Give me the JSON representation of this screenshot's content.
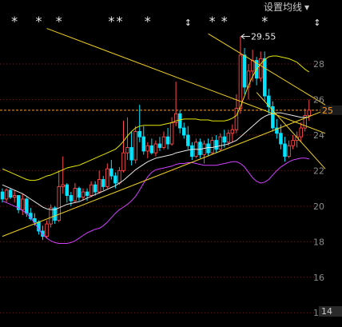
{
  "header": {
    "ma_settings_label": "设置均线",
    "dropdown_icon": "caret-down-icon"
  },
  "colors": {
    "background": "#000000",
    "grid": "#6e1a1a",
    "up": "#ff4a4a",
    "down": "#00e4ff",
    "boll_mid": "#e6e6e6",
    "boll_upper": "#e6e600",
    "boll_lower": "#d040ff",
    "trend": "#f0d020",
    "last_price": "#ff9a1a",
    "axis_text": "#8c8c8c",
    "star": "#e8e8e8"
  },
  "chart_data": {
    "type": "candlestick",
    "title": "",
    "xlabel": "",
    "ylabel": "",
    "ylim": [
      13.2,
      31.6
    ],
    "y_tick_labels": [
      "28",
      "26",
      "24",
      "22",
      "20",
      "18",
      "16",
      "14"
    ],
    "y_ticks": [
      28,
      26,
      24,
      22,
      20,
      18,
      16,
      14
    ],
    "grid": true,
    "current_price": 25.4,
    "current_price_tag": "25",
    "right_edge_tags": [
      {
        "text": "14",
        "value": 14.1
      }
    ],
    "annotation": {
      "text": "29.55",
      "value": 29.55
    },
    "marker_symbols": [
      "*",
      "*",
      "*",
      "*",
      "*",
      "*",
      "↕",
      "*",
      "*",
      "*",
      "↕"
    ],
    "candles": [
      [
        20.8,
        21.0,
        20.2,
        20.4
      ],
      [
        20.4,
        21.0,
        20.2,
        20.9
      ],
      [
        20.9,
        21.0,
        20.4,
        20.5
      ],
      [
        20.5,
        20.9,
        20.2,
        20.6
      ],
      [
        20.6,
        20.6,
        19.6,
        19.8
      ],
      [
        19.8,
        20.7,
        19.5,
        20.4
      ],
      [
        20.4,
        20.5,
        19.4,
        19.6
      ],
      [
        19.6,
        19.9,
        19.2,
        19.3
      ],
      [
        19.3,
        19.6,
        18.9,
        19.1
      ],
      [
        19.1,
        19.2,
        18.4,
        18.6
      ],
      [
        18.6,
        18.9,
        18.1,
        18.3
      ],
      [
        18.3,
        19.2,
        18.2,
        19.0
      ],
      [
        19.0,
        20.1,
        18.8,
        19.9
      ],
      [
        19.9,
        20.0,
        19.0,
        19.2
      ],
      [
        19.2,
        22.0,
        19.1,
        21.1
      ],
      [
        21.1,
        22.8,
        20.7,
        21.2
      ],
      [
        21.2,
        21.3,
        20.2,
        20.6
      ],
      [
        20.6,
        20.8,
        20.0,
        20.3
      ],
      [
        20.3,
        21.3,
        20.2,
        21.0
      ],
      [
        21.0,
        21.1,
        20.3,
        20.5
      ],
      [
        20.5,
        21.0,
        20.3,
        20.8
      ],
      [
        20.8,
        21.0,
        20.3,
        20.6
      ],
      [
        20.6,
        21.4,
        20.5,
        21.2
      ],
      [
        21.2,
        21.4,
        20.6,
        20.8
      ],
      [
        20.8,
        22.0,
        20.7,
        21.5
      ],
      [
        21.5,
        21.7,
        20.9,
        21.1
      ],
      [
        21.1,
        22.4,
        21.0,
        22.1
      ],
      [
        22.1,
        22.6,
        21.5,
        21.7
      ],
      [
        21.7,
        21.9,
        21.0,
        21.3
      ],
      [
        21.3,
        22.2,
        21.2,
        22.0
      ],
      [
        22.0,
        24.8,
        21.9,
        23.0
      ],
      [
        23.0,
        25.0,
        22.6,
        23.3
      ],
      [
        23.3,
        24.2,
        22.3,
        22.6
      ],
      [
        22.6,
        24.5,
        22.4,
        24.2
      ],
      [
        24.2,
        25.7,
        23.6,
        23.9
      ],
      [
        23.9,
        24.5,
        22.9,
        23.1
      ],
      [
        23.1,
        23.6,
        22.7,
        23.4
      ],
      [
        23.4,
        23.8,
        22.9,
        23.0
      ],
      [
        23.0,
        23.7,
        22.8,
        23.5
      ],
      [
        23.5,
        23.9,
        23.1,
        23.3
      ],
      [
        23.3,
        24.2,
        23.2,
        23.9
      ],
      [
        23.9,
        24.4,
        23.2,
        23.5
      ],
      [
        23.5,
        25.0,
        23.4,
        24.7
      ],
      [
        24.7,
        27.0,
        24.5,
        25.2
      ],
      [
        25.2,
        25.4,
        24.1,
        24.4
      ],
      [
        24.4,
        24.7,
        23.8,
        24.0
      ],
      [
        24.0,
        24.5,
        23.2,
        23.4
      ],
      [
        23.4,
        23.6,
        22.6,
        22.8
      ],
      [
        22.8,
        23.8,
        22.7,
        23.6
      ],
      [
        23.6,
        23.8,
        22.7,
        22.9
      ],
      [
        22.9,
        23.7,
        22.4,
        23.5
      ],
      [
        23.5,
        23.8,
        22.8,
        23.0
      ],
      [
        23.0,
        23.9,
        22.9,
        23.7
      ],
      [
        23.7,
        24.0,
        23.0,
        23.2
      ],
      [
        23.2,
        24.1,
        23.1,
        23.9
      ],
      [
        23.9,
        24.3,
        23.3,
        23.6
      ],
      [
        23.6,
        24.3,
        23.4,
        24.1
      ],
      [
        24.1,
        24.6,
        23.6,
        24.3
      ],
      [
        24.3,
        26.3,
        24.1,
        25.5
      ],
      [
        25.5,
        29.55,
        25.2,
        28.5
      ],
      [
        28.5,
        28.9,
        26.3,
        26.7
      ],
      [
        26.7,
        28.0,
        26.0,
        27.6
      ],
      [
        27.6,
        28.8,
        27.0,
        28.2
      ],
      [
        28.2,
        28.4,
        26.8,
        27.2
      ],
      [
        27.2,
        28.7,
        27.0,
        28.3
      ],
      [
        28.3,
        28.7,
        25.9,
        26.2
      ],
      [
        26.2,
        26.6,
        25.2,
        25.6
      ],
      [
        25.6,
        25.9,
        24.2,
        24.4
      ],
      [
        24.4,
        24.9,
        23.8,
        24.1
      ],
      [
        24.1,
        24.6,
        23.2,
        23.5
      ],
      [
        23.5,
        23.9,
        22.5,
        22.8
      ],
      [
        22.8,
        23.7,
        22.7,
        23.4
      ],
      [
        23.4,
        24.0,
        23.2,
        23.7
      ],
      [
        23.7,
        24.2,
        23.3,
        23.9
      ],
      [
        23.9,
        24.7,
        23.6,
        24.4
      ],
      [
        24.4,
        25.5,
        24.2,
        25.1
      ],
      [
        25.1,
        26.0,
        24.8,
        25.4
      ]
    ],
    "boll": {
      "mid": [
        21.2,
        21.1,
        21.0,
        20.9,
        20.8,
        20.7,
        20.55,
        20.4,
        20.25,
        20.1,
        19.95,
        19.85,
        19.8,
        19.8,
        19.9,
        20.0,
        20.1,
        20.15,
        20.2,
        20.25,
        20.35,
        20.45,
        20.55,
        20.65,
        20.75,
        20.85,
        20.95,
        21.05,
        21.15,
        21.3,
        21.45,
        21.65,
        21.85,
        22.05,
        22.2,
        22.35,
        22.5,
        22.6,
        22.7,
        22.75,
        22.8,
        22.85,
        22.9,
        23.0,
        23.05,
        23.1,
        23.15,
        23.2,
        23.2,
        23.2,
        23.25,
        23.3,
        23.3,
        23.35,
        23.4,
        23.45,
        23.5,
        23.6,
        23.7,
        23.9,
        24.1,
        24.3,
        24.5,
        24.7,
        24.9,
        25.05,
        25.15,
        25.2,
        25.25,
        25.25,
        25.2,
        25.15,
        25.1,
        25.05,
        25.0,
        25.0,
        25.0
      ],
      "upper": [
        22.1,
        22.0,
        21.9,
        21.8,
        21.7,
        21.6,
        21.5,
        21.45,
        21.45,
        21.5,
        21.6,
        21.7,
        21.75,
        21.85,
        21.95,
        22.05,
        22.15,
        22.2,
        22.25,
        22.3,
        22.4,
        22.5,
        22.6,
        22.7,
        22.8,
        22.9,
        23.0,
        23.1,
        23.2,
        23.4,
        23.65,
        23.95,
        24.2,
        24.4,
        24.5,
        24.55,
        24.55,
        24.55,
        24.55,
        24.55,
        24.6,
        24.65,
        24.7,
        24.8,
        24.85,
        24.9,
        24.9,
        24.9,
        24.9,
        24.85,
        24.85,
        24.85,
        24.8,
        24.8,
        24.8,
        24.8,
        24.85,
        24.95,
        25.1,
        25.6,
        26.2,
        26.8,
        27.3,
        27.7,
        28.0,
        28.25,
        28.4,
        28.45,
        28.45,
        28.4,
        28.35,
        28.3,
        28.2,
        28.1,
        27.9,
        27.7,
        27.55
      ],
      "lower": [
        20.3,
        20.2,
        20.1,
        20.0,
        19.9,
        19.75,
        19.6,
        19.35,
        19.05,
        18.7,
        18.4,
        18.2,
        18.05,
        17.95,
        17.9,
        17.9,
        17.9,
        17.95,
        18.05,
        18.2,
        18.35,
        18.5,
        18.6,
        18.7,
        18.75,
        18.9,
        19.1,
        19.35,
        19.6,
        19.8,
        19.95,
        20.1,
        20.3,
        20.55,
        20.9,
        21.3,
        21.65,
        21.9,
        22.05,
        22.1,
        22.15,
        22.2,
        22.25,
        22.35,
        22.4,
        22.4,
        22.45,
        22.45,
        22.4,
        22.35,
        22.3,
        22.3,
        22.3,
        22.3,
        22.35,
        22.4,
        22.45,
        22.5,
        22.5,
        22.4,
        22.2,
        21.9,
        21.6,
        21.4,
        21.3,
        21.35,
        21.5,
        21.75,
        22.0,
        22.2,
        22.35,
        22.5,
        22.6,
        22.65,
        22.7,
        22.7,
        22.65
      ]
    },
    "trendlines": [
      {
        "from": [
          0,
          18.3
        ],
        "to": [
          80,
          25.4
        ]
      },
      {
        "from": [
          11,
          30.0
        ],
        "to": [
          80,
          24.1
        ]
      },
      {
        "from": [
          51,
          29.7
        ],
        "to": [
          80,
          25.7
        ]
      },
      {
        "from": [
          63,
          26.4
        ],
        "to": [
          80,
          22.1
        ]
      }
    ]
  }
}
